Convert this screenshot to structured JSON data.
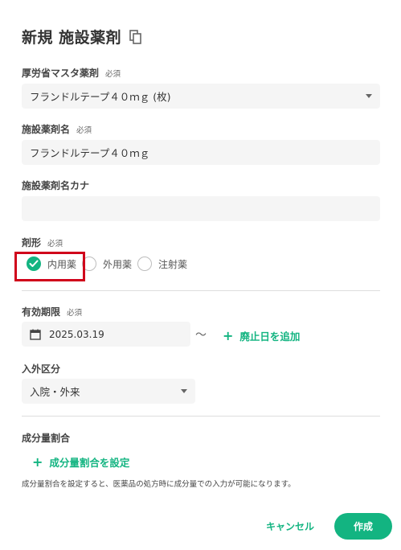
{
  "dialog": {
    "title": "新規 施設薬剤"
  },
  "mhlw_drug": {
    "label": "厚労省マスタ薬剤",
    "required": "必須",
    "value": "フランドルテープ４０ｍｇ (枚)"
  },
  "facility_drug_name": {
    "label": "施設薬剤名",
    "required": "必須",
    "value": "フランドルテープ４０ｍｇ"
  },
  "facility_drug_kana": {
    "label": "施設薬剤名カナ",
    "value": ""
  },
  "dosage_form": {
    "label": "剤形",
    "required": "必須",
    "options": [
      {
        "label": "内用薬",
        "checked": true
      },
      {
        "label": "外用薬",
        "checked": false
      },
      {
        "label": "注射薬",
        "checked": false
      }
    ]
  },
  "validity": {
    "label": "有効期限",
    "required": "必須",
    "start_date": "2025.03.19",
    "separator": "〜",
    "add_end_date": "廃止日を追加"
  },
  "inpatient_outpatient": {
    "label": "入外区分",
    "value": "入院・外来"
  },
  "ingredient_ratio": {
    "label": "成分量割合",
    "set_link": "成分量割合を設定",
    "hint": "成分量割合を設定すると、医薬品の処方時に成分量での入力が可能になります。"
  },
  "footer": {
    "cancel": "キャンセル",
    "create": "作成"
  },
  "colors": {
    "accent": "#13b481",
    "highlight": "#d0021b"
  }
}
